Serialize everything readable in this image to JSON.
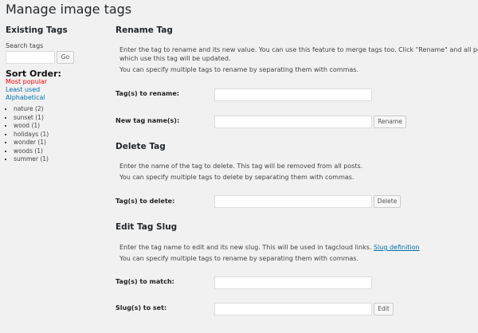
{
  "title": "Manage image tags",
  "sidebar": {
    "heading": "Existing Tags",
    "search_label": "Search tags",
    "search_value": "",
    "go": "Go",
    "sort_heading": "Sort Order:",
    "sort": [
      "Most popular",
      "Least used",
      "Alphabetical"
    ],
    "tags": [
      "nature (2)",
      "sunset (1)",
      "wood (1)",
      "holidays (1)",
      "wonder (1)",
      "woods (1)",
      "summer (1)"
    ]
  },
  "rename": {
    "heading": "Rename Tag",
    "p1": "Enter the tag to rename and its new value. You can use this feature to merge tags too. Click \"Rename\" and all posts",
    "p2": "which use this tag will be updated.",
    "p3": "You can specify multiple tags to rename by separating them with commas.",
    "label1": "Tag(s) to rename:",
    "label2": "New tag name(s):",
    "button": "Rename"
  },
  "delete": {
    "heading": "Delete Tag",
    "p1": "Enter the name of the tag to delete. This tag will be removed from all posts.",
    "p2": "You can specify multiple tags to delete by separating them with commas.",
    "label": "Tag(s) to delete:",
    "button": "Delete"
  },
  "slug": {
    "heading": "Edit Tag Slug",
    "p1": "Enter the tag name to edit and its new slug. This will be used in tagcloud links.",
    "link": "Slug definition",
    "p2": "You can specify multiple tags to rename by separating them with commas.",
    "label1": "Tag(s) to match:",
    "label2": "Slug(s) to set:",
    "button": "Edit"
  }
}
